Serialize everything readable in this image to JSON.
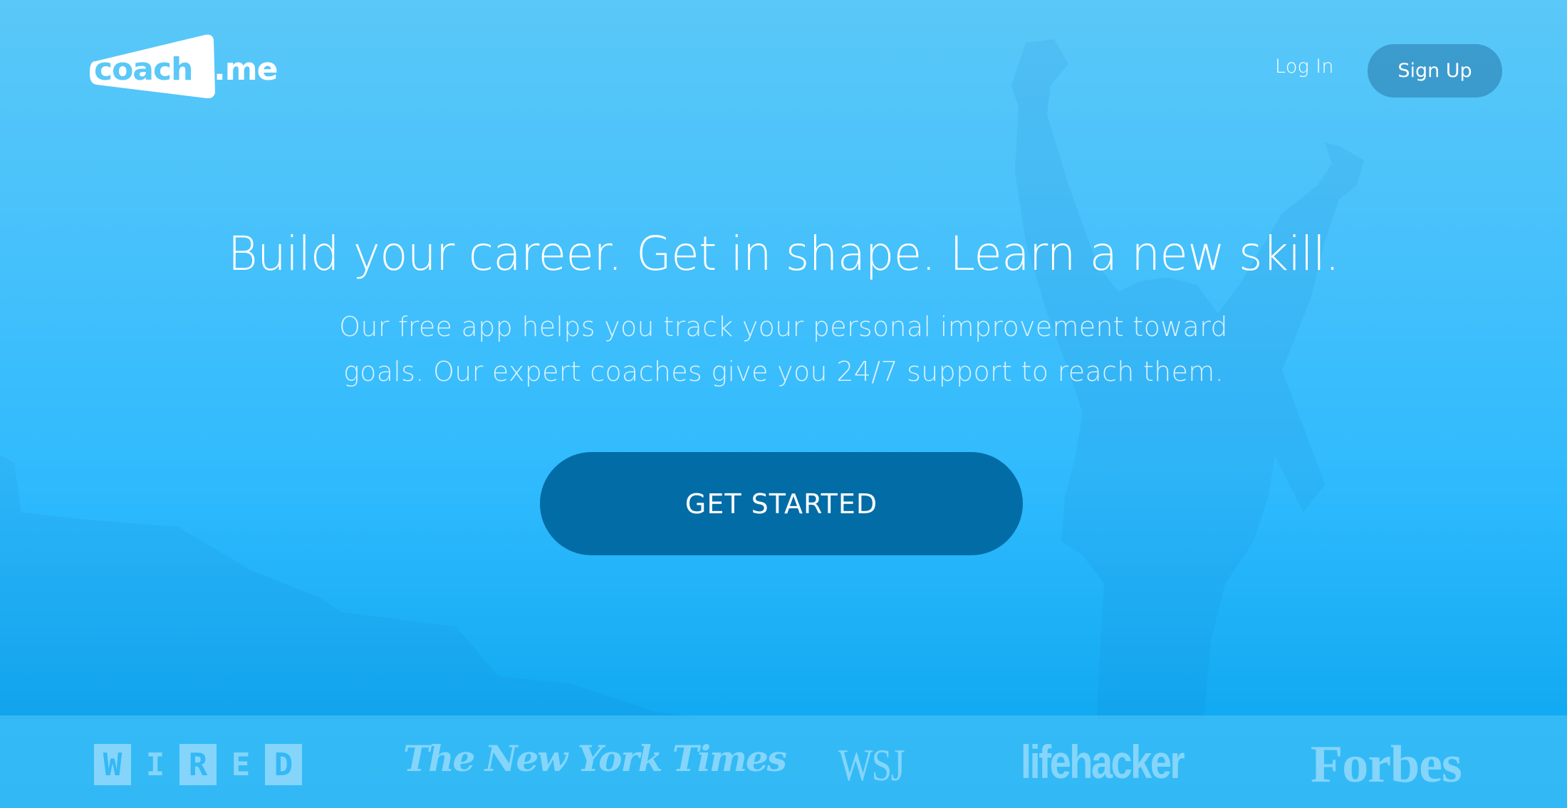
{
  "brand": {
    "name_main": "coach",
    "name_suffix": ".me",
    "colors": {
      "background_top": "#5ac8f8",
      "background_bottom": "#0fa6ef",
      "cta_button": "#026ca6",
      "signup_button": "#3a90c0",
      "text": "#ffffff"
    }
  },
  "nav": {
    "login_label": "Log In",
    "signup_label": "Sign Up"
  },
  "hero": {
    "headline": "Build your career. Get in shape. Learn a new skill.",
    "subtitle_line1": "Our free app helps you track your personal improvement toward",
    "subtitle_line2": "goals. Our expert coaches give you 24/7 support to reach them.",
    "cta_label": "GET STARTED",
    "background_image": "silhouette-person-arms-raised"
  },
  "press": {
    "logos": [
      {
        "name": "WIRED",
        "letters": [
          "W",
          "I",
          "R",
          "E",
          "D"
        ]
      },
      {
        "name": "The New York Times"
      },
      {
        "name": "WSJ"
      },
      {
        "name": "lifehacker"
      },
      {
        "name": "Forbes"
      }
    ]
  }
}
